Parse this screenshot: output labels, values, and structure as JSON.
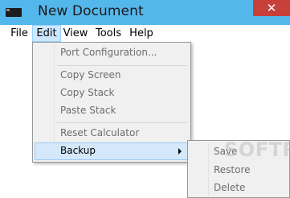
{
  "window": {
    "title": "New Document",
    "close_glyph": "✕"
  },
  "menubar": {
    "items": [
      {
        "label": "File"
      },
      {
        "label": "Edit"
      },
      {
        "label": "View"
      },
      {
        "label": "Tools"
      },
      {
        "label": "Help"
      }
    ]
  },
  "edit_menu": {
    "items": [
      {
        "label": "Port Configuration...",
        "enabled": false
      },
      {
        "label": "Copy Screen",
        "enabled": false
      },
      {
        "label": "Copy Stack",
        "enabled": false
      },
      {
        "label": "Paste Stack",
        "enabled": false
      },
      {
        "label": "Reset Calculator",
        "enabled": false
      },
      {
        "label": "Backup",
        "enabled": true,
        "highlighted": true,
        "has_submenu": true
      }
    ]
  },
  "backup_submenu": {
    "items": [
      {
        "label": "Save",
        "enabled": false
      },
      {
        "label": "Restore",
        "enabled": false
      },
      {
        "label": "Delete",
        "enabled": false
      }
    ]
  },
  "watermark": {
    "text": "SOFTPEDIA"
  },
  "colors": {
    "titlebar": "#54b7eb",
    "close_button": "#c7403a",
    "menu_highlight": "#d5e8fb",
    "disabled_text": "#6d6d6d"
  }
}
